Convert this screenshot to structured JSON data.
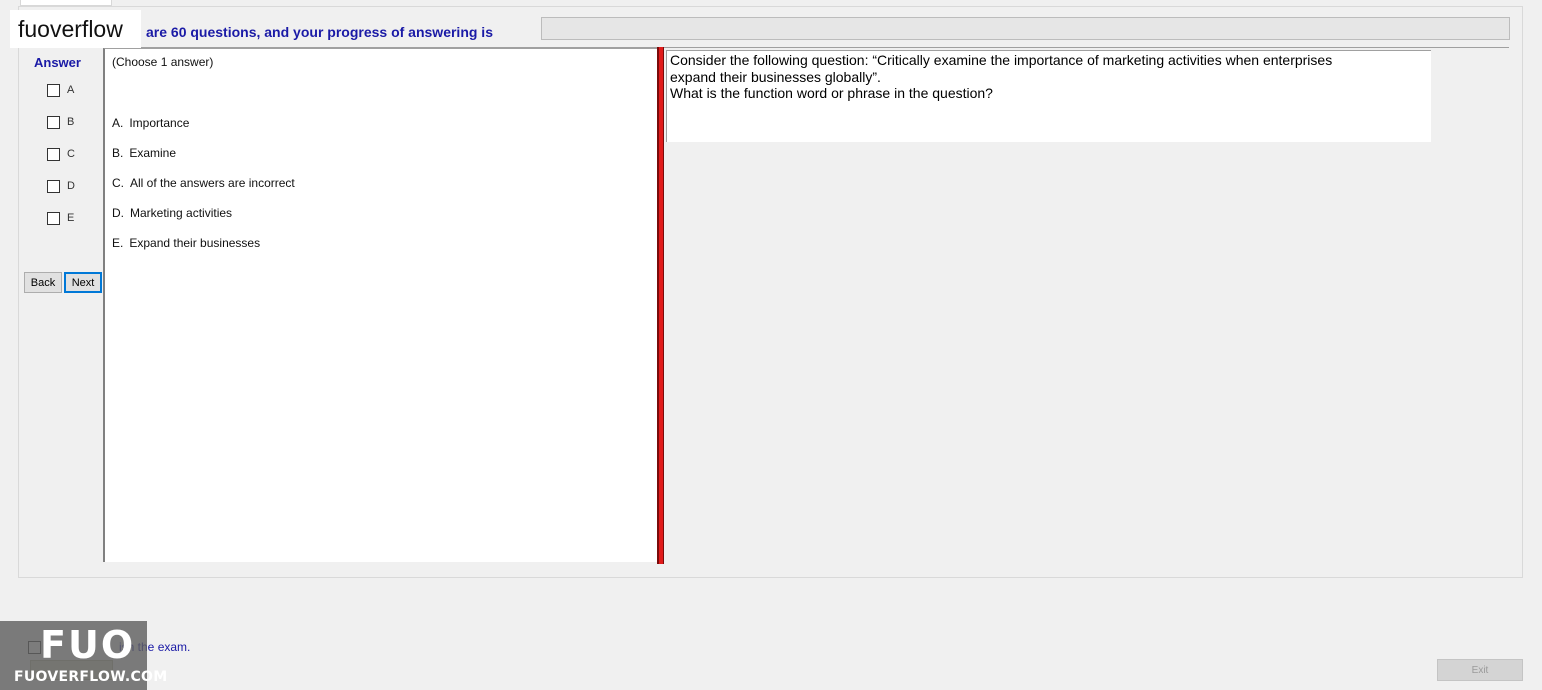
{
  "header": {
    "logo_text": "fuoverflow",
    "progress_label": "are 60 questions, and your progress of answering is",
    "progress": 0
  },
  "answer_panel": {
    "title": "Answer",
    "options": [
      "A",
      "B",
      "C",
      "D",
      "E"
    ],
    "back_label": "Back",
    "next_label": "Next"
  },
  "choices": {
    "hint": "(Choose 1 answer)",
    "items": [
      {
        "letter": "A.",
        "text": "Importance"
      },
      {
        "letter": "B.",
        "text": "Examine"
      },
      {
        "letter": "C.",
        "text": "All of the answers are incorrect"
      },
      {
        "letter": "D.",
        "text": "Marketing activities"
      },
      {
        "letter": "E.",
        "text": "Expand their businesses"
      }
    ]
  },
  "question": {
    "lines": [
      "Consider the following question: “Critically examine the importance of marketing activities when enterprises",
      "expand their businesses globally”.",
      "What is the function word or phrase in the question?"
    ]
  },
  "footer": {
    "finish_label": "ish the exam.",
    "finish_button_label": "",
    "exit_label": "Exit"
  },
  "watermark": {
    "big": "FUO",
    "small": "FUOVERFLOW.COM"
  },
  "colors": {
    "label_blue": "#1a1aa6",
    "splitter_red": "#e11b1b"
  }
}
